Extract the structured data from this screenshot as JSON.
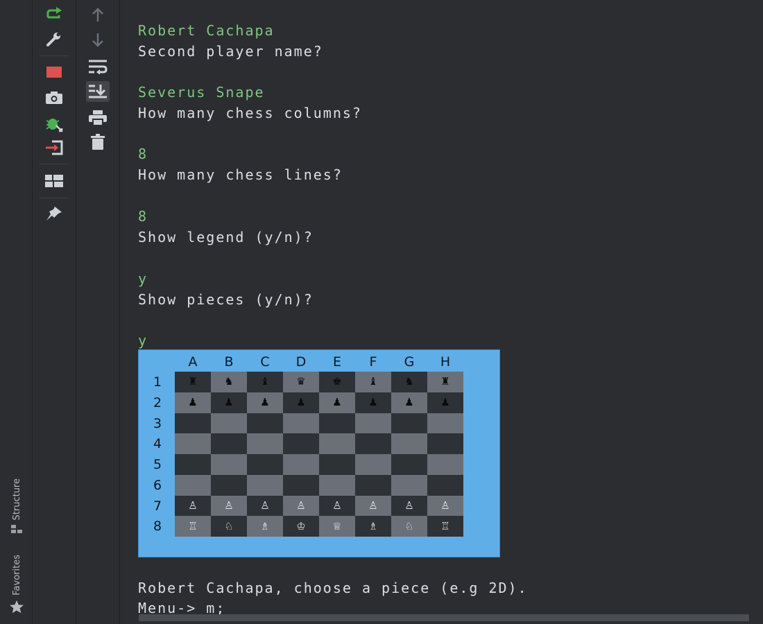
{
  "sidebar": {
    "structure_label": "Structure",
    "favorites_label": "Favorites"
  },
  "console": {
    "lines": [
      {
        "kind": "input",
        "text": "Robert Cachapa"
      },
      {
        "kind": "out",
        "text": "Second player name?"
      },
      {
        "kind": "input",
        "text": "Severus Snape"
      },
      {
        "kind": "out",
        "text": "How many chess columns?"
      },
      {
        "kind": "input",
        "text": "8"
      },
      {
        "kind": "out",
        "text": "How many chess lines?"
      },
      {
        "kind": "input",
        "text": "8"
      },
      {
        "kind": "out",
        "text": "Show legend (y/n)?"
      },
      {
        "kind": "input",
        "text": "y"
      },
      {
        "kind": "out",
        "text": "Show pieces (y/n)?"
      },
      {
        "kind": "input",
        "text": "y"
      }
    ],
    "prompt_line": "Robert Cachapa, choose a piece (e.g 2D).",
    "menu_line": "Menu-> m;"
  },
  "board": {
    "columns": [
      "A",
      "B",
      "C",
      "D",
      "E",
      "F",
      "G",
      "H"
    ],
    "rows": [
      "1",
      "2",
      "3",
      "4",
      "5",
      "6",
      "7",
      "8"
    ],
    "pieces": [
      [
        "♜",
        "♞",
        "♝",
        "♛",
        "♚",
        "♝",
        "♞",
        "♜"
      ],
      [
        "♟",
        "♟",
        "♟",
        "♟",
        "♟",
        "♟",
        "♟",
        "♟"
      ],
      [
        "",
        "",
        "",
        "",
        "",
        "",
        "",
        ""
      ],
      [
        "",
        "",
        "",
        "",
        "",
        "",
        "",
        ""
      ],
      [
        "",
        "",
        "",
        "",
        "",
        "",
        "",
        ""
      ],
      [
        "",
        "",
        "",
        "",
        "",
        "",
        "",
        ""
      ],
      [
        "♙",
        "♙",
        "♙",
        "♙",
        "♙",
        "♙",
        "♙",
        "♙"
      ],
      [
        "♖",
        "♘",
        "♗",
        "♔",
        "♕",
        "♗",
        "♘",
        "♖"
      ]
    ]
  },
  "colors": {
    "input_text": "#7fc77f",
    "output_text": "#dcdfe4",
    "board_bg": "#5faee8",
    "dark_square": "#2e3136",
    "light_square": "#6b6f77",
    "stop_red": "#d9534f",
    "rerun_green": "#4caf50"
  },
  "icons": {
    "toolbar1": [
      "rerun-icon",
      "wrench-icon",
      "stop-icon",
      "camera-icon",
      "debug-icon",
      "exit-icon",
      "layout-icon",
      "pin-icon"
    ],
    "toolbar2": [
      "arrow-up-icon",
      "arrow-down-icon",
      "soft-wrap-icon",
      "scroll-to-end-icon",
      "print-icon",
      "trash-icon"
    ]
  }
}
